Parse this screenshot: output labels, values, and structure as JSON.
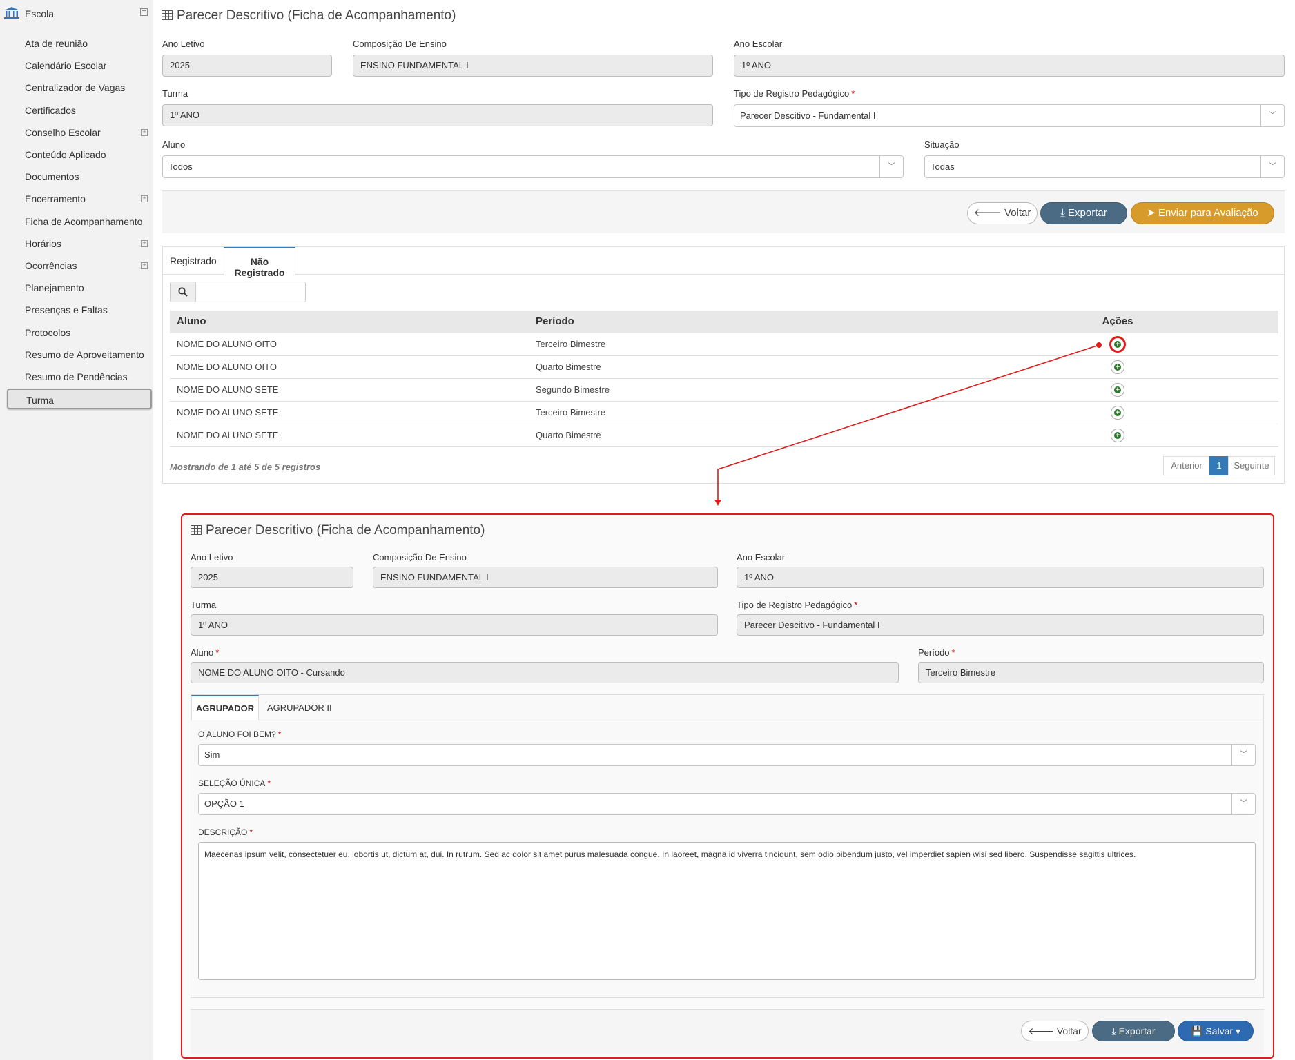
{
  "sidebar": {
    "header": "Escola",
    "items": [
      {
        "label": "Ata de reunião",
        "expandable": false
      },
      {
        "label": "Calendário Escolar",
        "expandable": false
      },
      {
        "label": "Centralizador de Vagas",
        "expandable": false
      },
      {
        "label": "Certificados",
        "expandable": false
      },
      {
        "label": "Conselho Escolar",
        "expandable": true
      },
      {
        "label": "Conteúdo Aplicado",
        "expandable": false
      },
      {
        "label": "Documentos",
        "expandable": false
      },
      {
        "label": "Encerramento",
        "expandable": true
      },
      {
        "label": "Ficha de Acompanhamento",
        "expandable": false
      },
      {
        "label": "Horários",
        "expandable": true
      },
      {
        "label": "Ocorrências",
        "expandable": true
      },
      {
        "label": "Planejamento",
        "expandable": false
      },
      {
        "label": "Presenças e Faltas",
        "expandable": false
      },
      {
        "label": "Protocolos",
        "expandable": false
      },
      {
        "label": "Resumo de Aproveitamento",
        "expandable": false
      },
      {
        "label": "Resumo de Pendências",
        "expandable": false
      },
      {
        "label": "Turma",
        "expandable": false,
        "active": true
      }
    ]
  },
  "top": {
    "title": "Parecer Descritivo (Ficha de Acompanhamento)",
    "labels": {
      "ano_letivo": "Ano Letivo",
      "composicao": "Composição De Ensino",
      "ano_escolar": "Ano Escolar",
      "turma": "Turma",
      "tipo_registro": "Tipo de Registro Pedagógico",
      "aluno": "Aluno",
      "situacao": "Situação"
    },
    "values": {
      "ano_letivo": "2025",
      "composicao": "ENSINO FUNDAMENTAL I",
      "ano_escolar": "1º ANO",
      "turma": "1º ANO",
      "tipo_registro": "Parecer Descitivo - Fundamental I",
      "aluno": "Todos",
      "situacao": "Todas"
    },
    "buttons": {
      "voltar": "Voltar",
      "exportar": "Exportar",
      "enviar": "Enviar para Avaliação"
    },
    "tabs": [
      "Registrado",
      "Não Registrado"
    ],
    "table": {
      "headers": [
        "Aluno",
        "Período",
        "Ações"
      ],
      "rows": [
        {
          "aluno": "NOME DO ALUNO OITO",
          "periodo": "Terceiro Bimestre"
        },
        {
          "aluno": "NOME DO ALUNO OITO",
          "periodo": "Quarto Bimestre"
        },
        {
          "aluno": "NOME DO ALUNO SETE",
          "periodo": "Segundo Bimestre"
        },
        {
          "aluno": "NOME DO ALUNO SETE",
          "periodo": "Terceiro Bimestre"
        },
        {
          "aluno": "NOME DO ALUNO SETE",
          "periodo": "Quarto Bimestre"
        }
      ]
    },
    "info": "Mostrando de 1 até 5 de 5 registros",
    "pagination": {
      "prev": "Anterior",
      "current": "1",
      "next": "Seguinte"
    }
  },
  "detail": {
    "title": "Parecer Descritivo (Ficha de Acompanhamento)",
    "labels": {
      "ano_letivo": "Ano Letivo",
      "composicao": "Composição De Ensino",
      "ano_escolar": "Ano Escolar",
      "turma": "Turma",
      "tipo_registro": "Tipo de Registro Pedagógico",
      "aluno": "Aluno",
      "periodo": "Período"
    },
    "values": {
      "ano_letivo": "2025",
      "composicao": "ENSINO FUNDAMENTAL I",
      "ano_escolar": "1º ANO",
      "turma": "1º ANO",
      "tipo_registro": "Parecer Descitivo - Fundamental I",
      "aluno": "NOME DO ALUNO OITO - Cursando",
      "periodo": "Terceiro Bimestre"
    },
    "tabs": [
      "AGRUPADOR",
      "AGRUPADOR II"
    ],
    "q1_label": "O ALUNO FOI BEM?",
    "q1_value": "Sim",
    "q2_label": "SELEÇÃO ÚNICA",
    "q2_value": "OPÇÃO 1",
    "q3_label": "DESCRIÇÃO",
    "q3_value": "Maecenas ipsum velit, consectetuer eu, lobortis ut, dictum at, dui. In rutrum. Sed ac dolor sit amet purus malesuada congue. In laoreet, magna id viverra tincidunt, sem odio bibendum justo, vel imperdiet sapien wisi sed libero. Suspendisse sagittis ultrices.",
    "buttons": {
      "voltar": "Voltar",
      "exportar": "Exportar",
      "salvar": "Salvar"
    }
  },
  "colors": {
    "accent": "#337ab7",
    "export": "#4b6b84",
    "send": "#d79b2b",
    "save": "#2e6ab1",
    "highlight": "#e01b1b",
    "add_icon": "#2d7a2d"
  },
  "icons": {
    "school": "bank-icon",
    "title": "table-grid-icon",
    "back": "arrow-left-icon",
    "export": "download-icon",
    "send": "paper-plane-icon",
    "save": "floppy-disk-icon",
    "search": "search-icon",
    "add": "plus-circle-icon"
  }
}
